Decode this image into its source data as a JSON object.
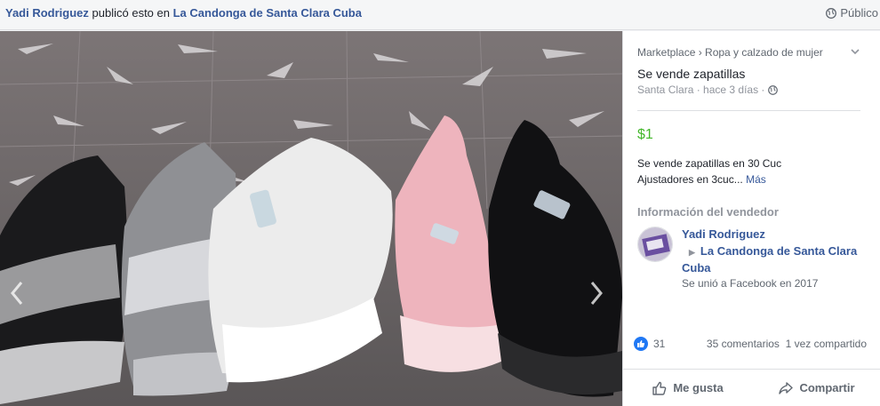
{
  "header": {
    "poster": "Yadi Rodriguez",
    "action_text": "publicó esto en",
    "group": "La Candonga de Santa Clara Cuba",
    "privacy": "Público"
  },
  "listing": {
    "breadcrumb": "Marketplace › Ropa y calzado de mujer",
    "title": "Se vende zapatillas",
    "location_time": "Santa Clara · hace 3 días ·",
    "price": "$1",
    "description_line1": "Se vende zapatillas en 30 Cuc",
    "description_line2": "Ajustadores en 3cuc...",
    "more_link": "Más"
  },
  "seller": {
    "heading": "Información del vendedor",
    "name": "Yadi Rodriguez",
    "group": "La Candonga de Santa Clara Cuba",
    "joined": "Se unió a Facebook en 2017"
  },
  "engagement": {
    "likes": "31",
    "comments": "35 comentarios",
    "shares": "1 vez compartido"
  },
  "actions": {
    "like": "Me gusta",
    "share": "Compartir"
  },
  "colors": {
    "link": "#365899",
    "price": "#42b72a",
    "like_blue": "#2078f4"
  }
}
